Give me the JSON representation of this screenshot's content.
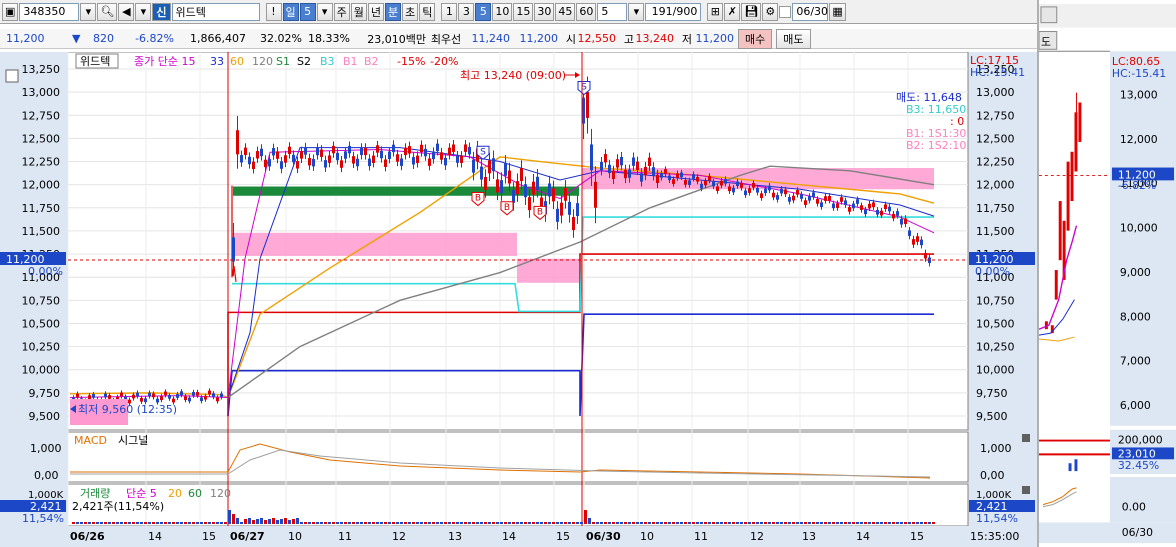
{
  "toolbar": {
    "code": "348350",
    "sin_label": "신",
    "stock_name": "위드텍",
    "info_icon": "!",
    "period_day": "일",
    "period_num": "5",
    "period_week": "주",
    "period_month": "월",
    "period_year": "년",
    "period_minute": "분",
    "period_second": "초",
    "period_tick": "틱",
    "minute_options": [
      "1",
      "3",
      "5",
      "10",
      "15",
      "30",
      "45",
      "60"
    ],
    "selected_minute": "5",
    "count_value": "5",
    "range_value": "191/900",
    "date_value": "06/30"
  },
  "quote": {
    "price": "11,200",
    "change": "820",
    "change_pct": "-6.82%",
    "volume": "1,866,407",
    "vol_ratio": "32.02%",
    "turnover": "18.33%",
    "amount": "23,010백만",
    "priority_label": "최우선",
    "ask": "11,240",
    "bid": "11,200",
    "open_label": "시",
    "open": "12,550",
    "high_label": "고",
    "high": "13,240",
    "low_label": "저",
    "low": "11,200",
    "buy_button": "매수",
    "sell_button": "매도"
  },
  "main_chart": {
    "legend": [
      "위드텍",
      "종가 단순 15",
      "33",
      "60",
      "120",
      "S1",
      "S2",
      "B3",
      "B1",
      "B2",
      "-15%",
      "-20%"
    ],
    "lc_label": "LC:17.15",
    "hc_label": "HC:-15.41",
    "high_marker": "최고 13,240 (09:00)",
    "low_marker": "최저 9,560 (12:35)",
    "price_axis": [
      "13,250",
      "13,000",
      "12,750",
      "12,500",
      "12,250",
      "12,000",
      "11,750",
      "11,500",
      "11,250",
      "11,000",
      "10,750",
      "10,500",
      "10,250",
      "10,000",
      "9,750",
      "9,500"
    ],
    "current_price_tag": "11,200",
    "current_pct_tag": "0.00%",
    "sell_label": "매도: 11,648",
    "b3_label": "B3: 11,650",
    "zero_label": ": 0",
    "b1_label": "B1: 1S1:30",
    "b2_label": "B2: 1S2:10",
    "signals": [
      "S",
      "B",
      "B",
      "B",
      "S"
    ]
  },
  "macd": {
    "title": "MACD",
    "signal_label": "시그널",
    "axis": [
      "1,000",
      "0,00"
    ]
  },
  "volume_pane": {
    "title": "거래량",
    "legend": [
      "단순 5",
      "20",
      "60",
      "120"
    ],
    "value_text": "2,421주(11,54%)",
    "axis_top": "1,000K",
    "tag_value": "2,421",
    "tag_pct": "11,54%"
  },
  "time_axis": [
    "06/26",
    "14",
    "15",
    "06/27",
    "10",
    "11",
    "12",
    "13",
    "14",
    "15",
    "06/30",
    "10",
    "11",
    "12",
    "13",
    "14",
    "15",
    "15:35:00"
  ],
  "right_panel": {
    "sell_tab": "도",
    "lc_label": "LC:80.65",
    "hc_label": "HC:-15.41",
    "price_axis": [
      "13,000",
      "12,000",
      "11,000",
      "10,000",
      "9,000",
      "8,000",
      "7,000",
      "6,000"
    ],
    "price_tag": "11,200",
    "pct_tag": "-6.82%",
    "vol_axis": "200,000",
    "vol_tag": "23,010",
    "vol_pct": "32.45%",
    "macd_axis": "0.00",
    "date_axis": "06/30"
  },
  "colors": {
    "up": "#e00000",
    "down": "#1c47c7",
    "ma15": "#d000d0",
    "ma33": "#1a2bd0",
    "ma60": "#f0a000",
    "ma120": "#808080",
    "b3": "#33dddd",
    "band": "#ff9ad0",
    "green_bar": "#1a8a3a"
  }
}
